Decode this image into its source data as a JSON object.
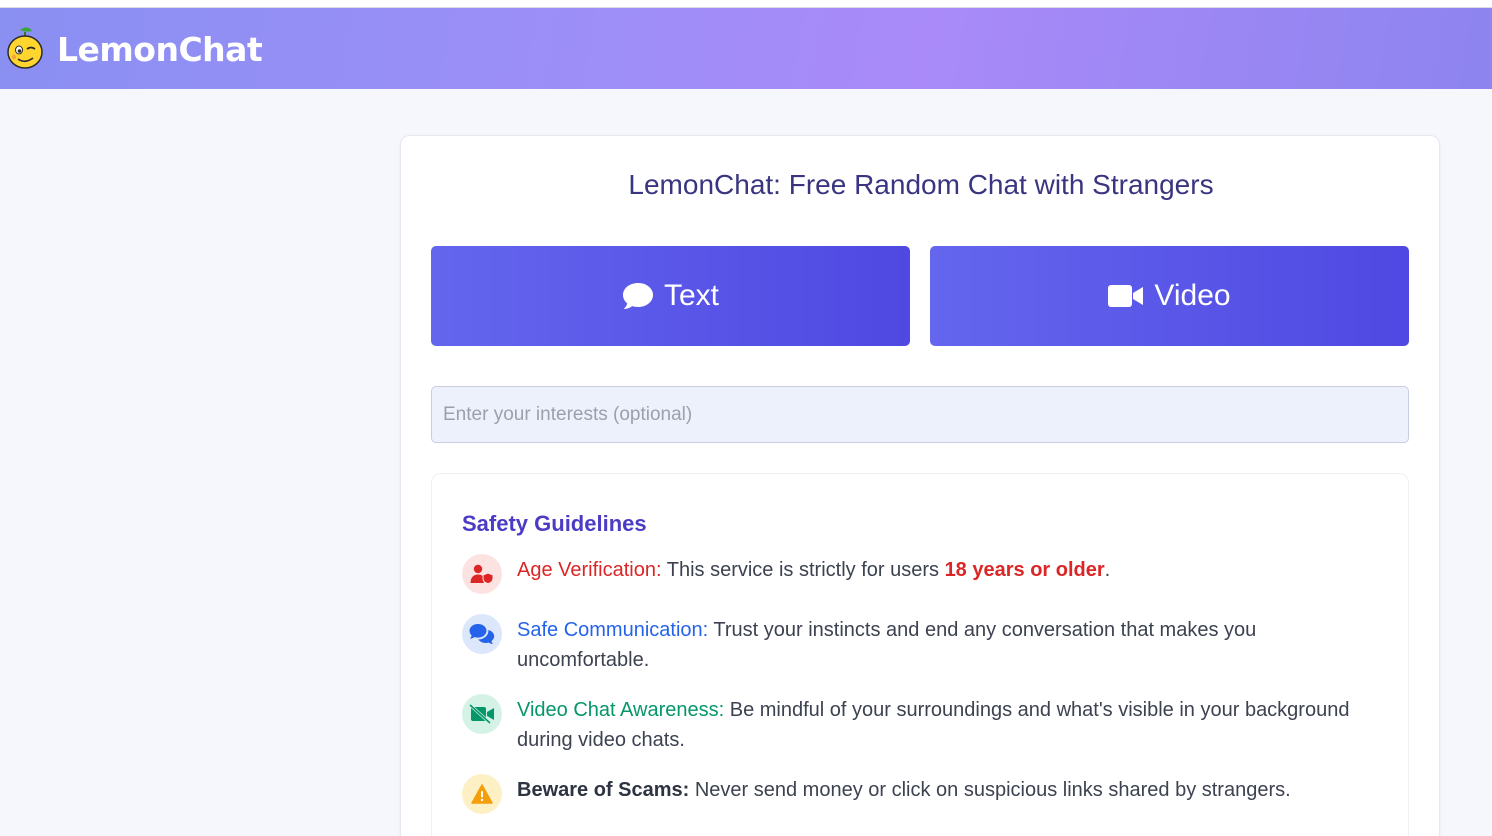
{
  "app": {
    "brand": "LemonChat"
  },
  "main": {
    "title": "LemonChat: Free Random Chat with Strangers",
    "text_button_label": "Text",
    "video_button_label": "Video",
    "interests_placeholder": "Enter your interests (optional)"
  },
  "safety": {
    "title": "Safety Guidelines",
    "items": [
      {
        "icon": "user-shield-icon",
        "color": "#dc2626",
        "label": "Age Verification:",
        "text_before": " This service is strictly for users ",
        "emphasis": "18 years or older",
        "text_after": "."
      },
      {
        "icon": "chat-bubbles-icon",
        "color": "#2563eb",
        "label": "Safe Communication:",
        "text": " Trust your instincts and end any conversation that makes you uncomfortable."
      },
      {
        "icon": "video-off-icon",
        "color": "#059669",
        "label": "Video Chat Awareness:",
        "text": " Be mindful of your surroundings and what's visible in your background during video chats."
      },
      {
        "icon": "warning-icon",
        "color": "#f59e0b",
        "label": "Beware of Scams:",
        "text": " Never send money or click on suspicious links shared by strangers."
      }
    ]
  },
  "colors": {
    "header_gradient": [
      "#8a8ff2",
      "#a98af8",
      "#8d84f0"
    ],
    "button": "#5552e8",
    "title": "#3a3580"
  }
}
